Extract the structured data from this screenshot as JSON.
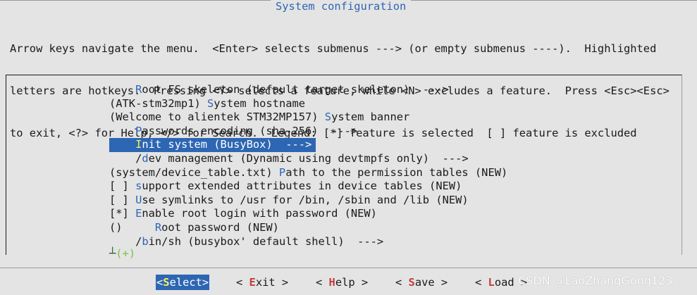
{
  "window": {
    "title": "System configuration"
  },
  "help": {
    "lines": [
      "Arrow keys navigate the menu.  <Enter> selects submenus ---> (or empty submenus ----).  Highlighted",
      "letters are hotkeys.  Pressing <Y> selects a feature, while <N> excludes a feature.  Press <Esc><Esc>",
      "to exit, <?> for Help, </> for Search.  Legend: [*] feature is selected  [ ] feature is excluded"
    ]
  },
  "menu": {
    "items": [
      {
        "pre": "    ",
        "hk": "R",
        "post": "oot FS skeleton (default target skeleton)  --->",
        "selected": false
      },
      {
        "pre": "(ATK-stm32mp1) ",
        "hk": "S",
        "post": "ystem hostname",
        "selected": false
      },
      {
        "pre": "(Welcome to alientek STM32MP157) ",
        "hk": "S",
        "post": "ystem banner",
        "selected": false
      },
      {
        "pre": "    ",
        "hk": "P",
        "post": "asswords encoding (sha-256)  --->",
        "selected": false
      },
      {
        "pre": "    ",
        "hk": "I",
        "post": "nit system (BusyBox)  --->",
        "selected": true
      },
      {
        "pre": "    /",
        "hk": "d",
        "post": "ev management (Dynamic using devtmpfs only)  --->",
        "selected": false
      },
      {
        "pre": "(system/device_table.txt) ",
        "hk": "P",
        "post": "ath to the permission tables (NEW)",
        "selected": false
      },
      {
        "pre": "[ ] ",
        "hk": "s",
        "post": "upport extended attributes in device tables (NEW)",
        "selected": false
      },
      {
        "pre": "[ ] ",
        "hk": "U",
        "post": "se symlinks to /usr for /bin, /sbin and /lib (NEW)",
        "selected": false
      },
      {
        "pre": "[*] ",
        "hk": "E",
        "post": "nable root login with password (NEW)",
        "selected": false
      },
      {
        "pre": "()     ",
        "hk": "R",
        "post": "oot password (NEW)",
        "selected": false
      },
      {
        "pre": "    /",
        "hk": "b",
        "post": "in/sh (busybox' default shell)  --->",
        "selected": false
      }
    ],
    "more_indicator": {
      "arrow": "┴",
      "text": "(+)"
    }
  },
  "buttons": [
    {
      "open": "<",
      "hk": "S",
      "rest": "elect",
      "close": ">",
      "active": true
    },
    {
      "open": "< ",
      "hk": "E",
      "rest": "xit",
      "close": " >",
      "active": false
    },
    {
      "open": "< ",
      "hk": "H",
      "rest": "elp",
      "close": " >",
      "active": false
    },
    {
      "open": "< ",
      "hk": "S",
      "rest": "ave",
      "close": " >",
      "active": false
    },
    {
      "open": "< ",
      "hk": "L",
      "rest": "oad",
      "close": " >",
      "active": false
    }
  ],
  "watermark": "CSDN @LaoZhangGong123",
  "colors": {
    "accent": "#2d66b3",
    "hotkey_selected": "#f5f25a",
    "button_hotkey": "#c23d3d",
    "more_indicator": "#7cc04b"
  }
}
